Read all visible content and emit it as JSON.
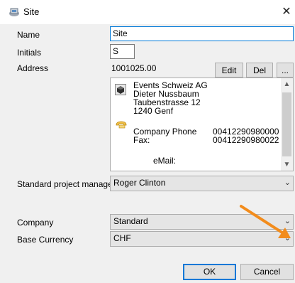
{
  "window": {
    "title": "Site",
    "close_glyph": "✕"
  },
  "form": {
    "name_label": "Name",
    "name_value": "Site",
    "initials_label": "Initials",
    "initials_value": "S",
    "address_label": "Address",
    "address_value": "1001025.00",
    "edit_button": "Edit",
    "del_button": "Del",
    "more_button": "...",
    "address_block": {
      "company": "Events Schweiz AG",
      "person": "Dieter Nussbaum",
      "street": "Taubenstrasse 12",
      "city": "1240 Genf",
      "company_phone_label": "Company Phone",
      "company_phone_value": "00412290980000",
      "fax_label": "Fax:",
      "fax_value": "00412290980022",
      "email_label": "eMail:"
    },
    "project_manager_label": "Standard project manager",
    "project_manager_value": "Roger Clinton",
    "company_label": "Company",
    "company_value": "Standard",
    "currency_label": "Base Currency",
    "currency_value": "CHF"
  },
  "footer": {
    "ok_label": "OK",
    "cancel_label": "Cancel"
  },
  "colors": {
    "annotation_arrow": "#f28c1c",
    "focus_border": "#0078d7"
  },
  "icons": [
    "site-icon",
    "contact-card-icon",
    "telephone-icon",
    "chevron-down-icon",
    "close-icon"
  ]
}
